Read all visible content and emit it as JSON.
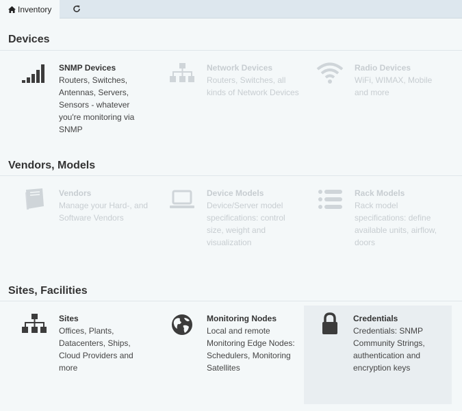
{
  "tabs": {
    "inventory_label": "Inventory"
  },
  "sections": {
    "devices": {
      "title": "Devices",
      "cards": [
        {
          "title": "SNMP Devices",
          "description": "Routers, Switches, Antennas, Servers, Sensors - whatever you're monitoring via SNMP",
          "icon": "signal-bars-icon",
          "enabled": true
        },
        {
          "title": "Network Devices",
          "description": "Routers, Switches, all kinds of Network Devices",
          "icon": "sitemap-icon",
          "enabled": false
        },
        {
          "title": "Radio Devices",
          "description": "WiFi, WIMAX, Mobile and more",
          "icon": "wifi-icon",
          "enabled": false
        }
      ]
    },
    "vendors": {
      "title": "Vendors, Models",
      "cards": [
        {
          "title": "Vendors",
          "description": "Manage your Hard-, and Software Vendors",
          "icon": "book-icon",
          "enabled": false
        },
        {
          "title": "Device Models",
          "description": "Device/Server model specifications: control size, weight and visualization",
          "icon": "laptop-icon",
          "enabled": false
        },
        {
          "title": "Rack Models",
          "description": "Rack model specifications: define available units, airflow, doors",
          "icon": "list-icon",
          "enabled": false
        }
      ]
    },
    "sites": {
      "title": "Sites, Facilities",
      "cards": [
        {
          "title": "Sites",
          "description": "Offices, Plants, Datacenters, Ships, Cloud Providers and more",
          "icon": "sitemap-icon",
          "enabled": true
        },
        {
          "title": "Monitoring Nodes",
          "description": "Local and remote Monitoring Edge Nodes: Schedulers, Monitoring Satellites",
          "icon": "globe-icon",
          "enabled": true
        },
        {
          "title": "Credentials",
          "description": "Credentials: SNMP Community Strings, authentication and encryption keys",
          "icon": "lock-icon",
          "enabled": true
        }
      ]
    }
  },
  "colors": {
    "background": "#f4f8f9",
    "tabbar": "#dde7ee",
    "enabled_text": "#333333",
    "disabled_text": "#c7cdd1",
    "highlight_card": "#e9eef1"
  }
}
